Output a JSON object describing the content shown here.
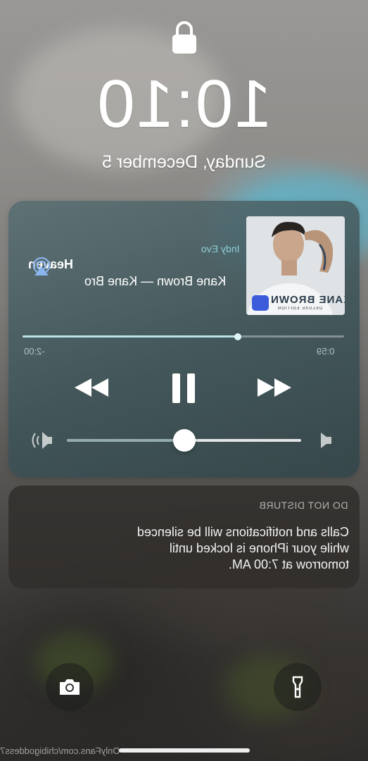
{
  "lock_screen": {
    "time": "10:10",
    "date": "Sunday, December 5"
  },
  "now_playing": {
    "source": "Indy Evo",
    "title": "Heaven",
    "artist_album": "Kane Brown — Kane Bro",
    "elapsed": "0:59",
    "remaining": "-2:00",
    "progress": 0.67,
    "volume": 0.5,
    "album_art": {
      "badge_text": "music",
      "title_text": "KANE BROWN",
      "edition_text": "DELUXE EDITION"
    },
    "accent_color": "#8ecfd6"
  },
  "dnd_notification": {
    "header": "DO NOT DISTURB",
    "lines": [
      "Calls and notifications will be silenced",
      "while your iPhone is locked until",
      "tomorrow at 7:00 AM."
    ]
  },
  "bottom_controls": {
    "camera_icon": "camera-icon",
    "flashlight_icon": "flashlight-icon"
  },
  "watermark": "OnlyFans.com/chibigoddess7"
}
